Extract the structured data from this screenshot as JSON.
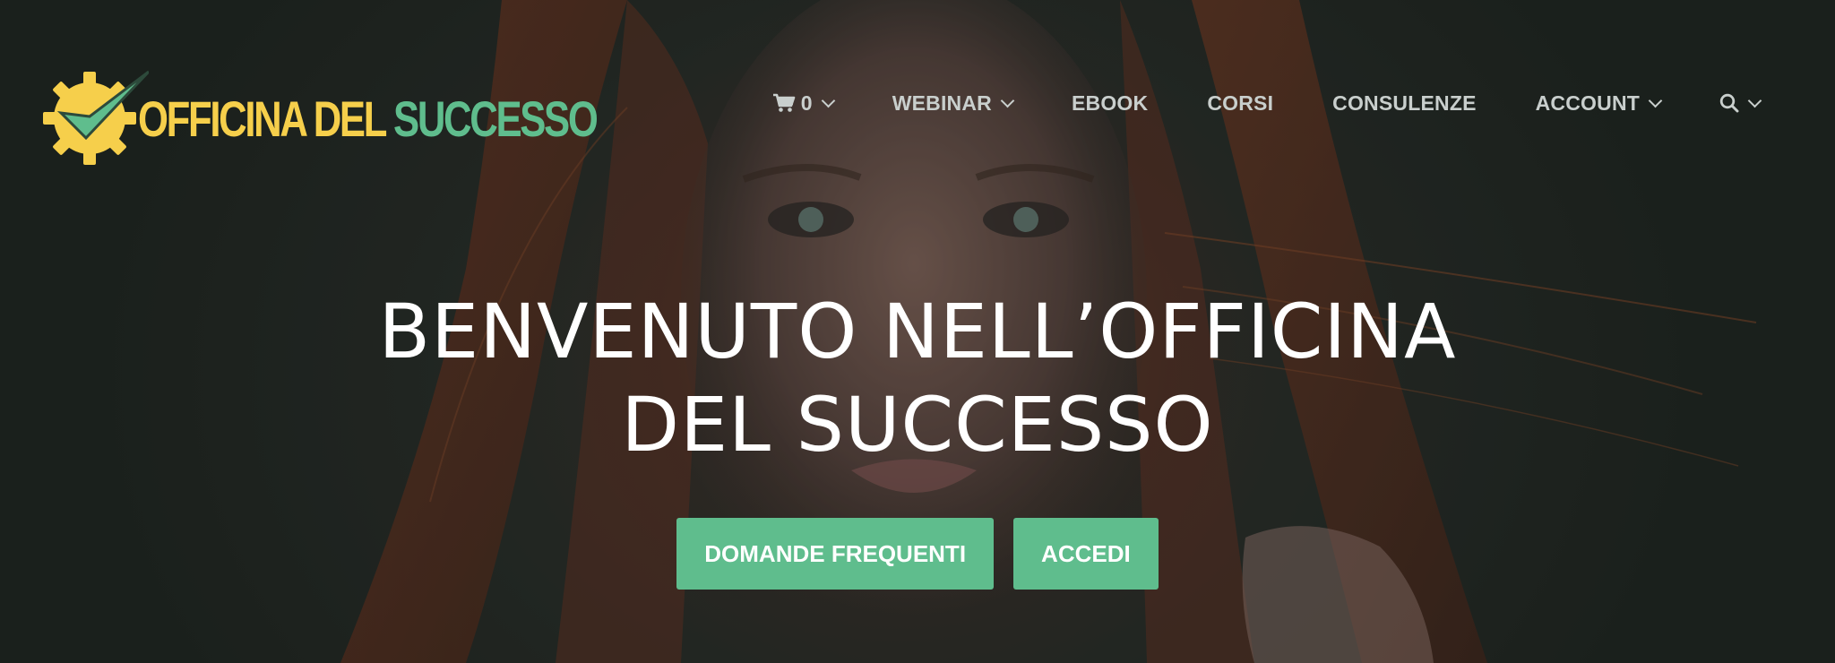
{
  "logo": {
    "text_part1": "OFFICINA DEL",
    "text_part2": "SUCCESSO",
    "colors": {
      "yellow": "#f6cf4b",
      "green": "#5fbd8d"
    }
  },
  "nav": {
    "cart": {
      "icon": "shopping-cart-icon",
      "count": "0"
    },
    "webinar": "WEBINAR",
    "ebook": "EBOOK",
    "corsi": "CORSI",
    "consulenze": "CONSULENZE",
    "account": "ACCOUNT",
    "search": {
      "icon": "search-icon"
    }
  },
  "hero": {
    "title_line1": "BENVENUTO NELL’OFFICINA",
    "title_line2": "DEL SUCCESSO",
    "buttons": {
      "faq": "DOMANDE FREQUENTI",
      "login": "ACCEDI"
    },
    "accent_color": "#5fbd8d"
  }
}
